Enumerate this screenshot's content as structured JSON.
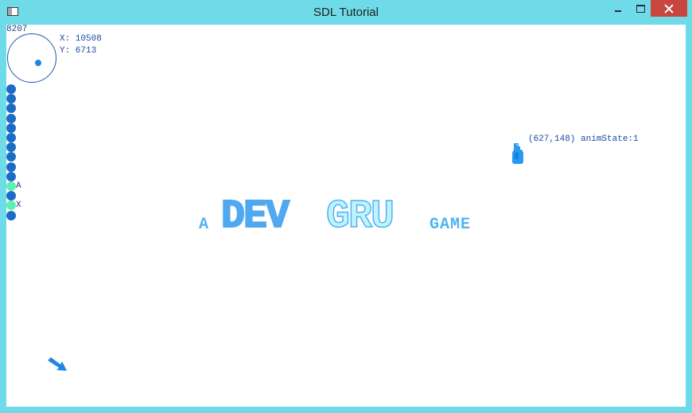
{
  "window": {
    "title": "SDL Tutorial"
  },
  "hud": {
    "frame_counter": "8207",
    "x_readout": "X: 10508",
    "y_readout": "Y: 6713"
  },
  "buttons": [
    {
      "state": "off",
      "label": ""
    },
    {
      "state": "off",
      "label": ""
    },
    {
      "state": "off",
      "label": ""
    },
    {
      "state": "off",
      "label": ""
    },
    {
      "state": "off",
      "label": ""
    },
    {
      "state": "off",
      "label": ""
    },
    {
      "state": "off",
      "label": ""
    },
    {
      "state": "off",
      "label": ""
    },
    {
      "state": "off",
      "label": ""
    },
    {
      "state": "off",
      "label": ""
    },
    {
      "state": "on",
      "label": "A"
    },
    {
      "state": "off",
      "label": ""
    },
    {
      "state": "on",
      "label": "X"
    },
    {
      "state": "off",
      "label": ""
    }
  ],
  "player": {
    "label": "(627,148) animState:1"
  },
  "logo": {
    "prefix": "A",
    "word_part1": "DEV",
    "word_part2": "GRU",
    "suffix": "GAME"
  },
  "colors": {
    "accent_dark": "#1c6cc6",
    "accent_mid": "#1e86e4",
    "button_active": "#5ef0b0",
    "logo_light": "#4fb4ef",
    "logo_pale": "#bff3ff"
  },
  "icons": {
    "arrow": "direction-arrow-icon",
    "player": "player-sprite-icon"
  }
}
